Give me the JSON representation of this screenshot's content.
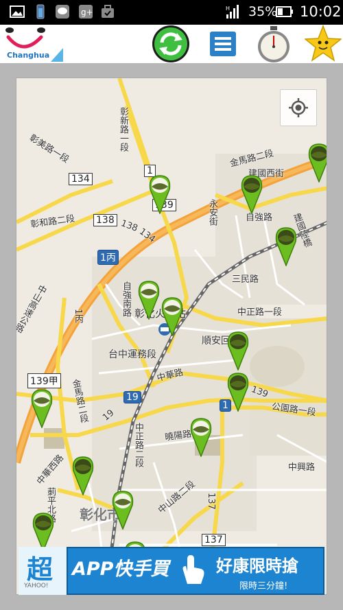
{
  "status_bar": {
    "battery_percent": "35%",
    "time": "10:02",
    "notification_icons": [
      "gallery-icon",
      "battery-widget-icon",
      "line-icon",
      "google-plus-icon",
      "briefcase-icon"
    ]
  },
  "header": {
    "logo_text": "Changhua",
    "buttons": [
      "refresh-icon",
      "menu-icon",
      "stopwatch-icon",
      "star-icon"
    ]
  },
  "map": {
    "labels": {
      "zhangxin_road": "彰新路一段",
      "zhangmei_road": "彰美路一段",
      "zhanghe_road": "彰和路二段",
      "jinma_road_1": "金馬路二段",
      "jianguo_w": "建國西街",
      "yongan": "永安街",
      "ziqiang_road": "自強路",
      "jianguo_bridge": "建國陸橋",
      "ziqiang_s": "自強南路",
      "sanmin_road": "三民路",
      "zhongzheng_road": "中正路一段",
      "station": "彰化火車站",
      "shunan": "順安回",
      "taichung_transport": "台中運務段",
      "zhonghua_road": "中華路",
      "gongyuan_road": "公園路一段",
      "jinma_road_2": "金馬路二段",
      "zhongxing_road": "中興路",
      "xiaoyang_road": "曉陽路",
      "zhongzheng_road_2": "中正路二段",
      "zhongshan_road": "中山路二段",
      "zhonghua_w": "中華西路",
      "zhongshan_highway": "中山高速公路",
      "nanping": "莿平北路",
      "city_name": "彰化市"
    },
    "route_shields": {
      "r1_top": "1",
      "r134_left": "134",
      "r138": "138",
      "r139_top": "139",
      "r1_bing": "1丙",
      "r139_jia": "139甲",
      "r19": "19",
      "r1_mid": "1",
      "r137": "137",
      "r138_road": "138",
      "r134_road": "134",
      "r139_road": "139",
      "r1_bing_road": "1丙",
      "r19_road": "19",
      "r137_road": "137"
    },
    "pins_count": 16
  },
  "ad": {
    "logo_char": "超",
    "logo_sub": "YAHOO!",
    "title": "APP快手買",
    "promo": "好康限時搶",
    "sub": "限時三分鐘!"
  }
}
